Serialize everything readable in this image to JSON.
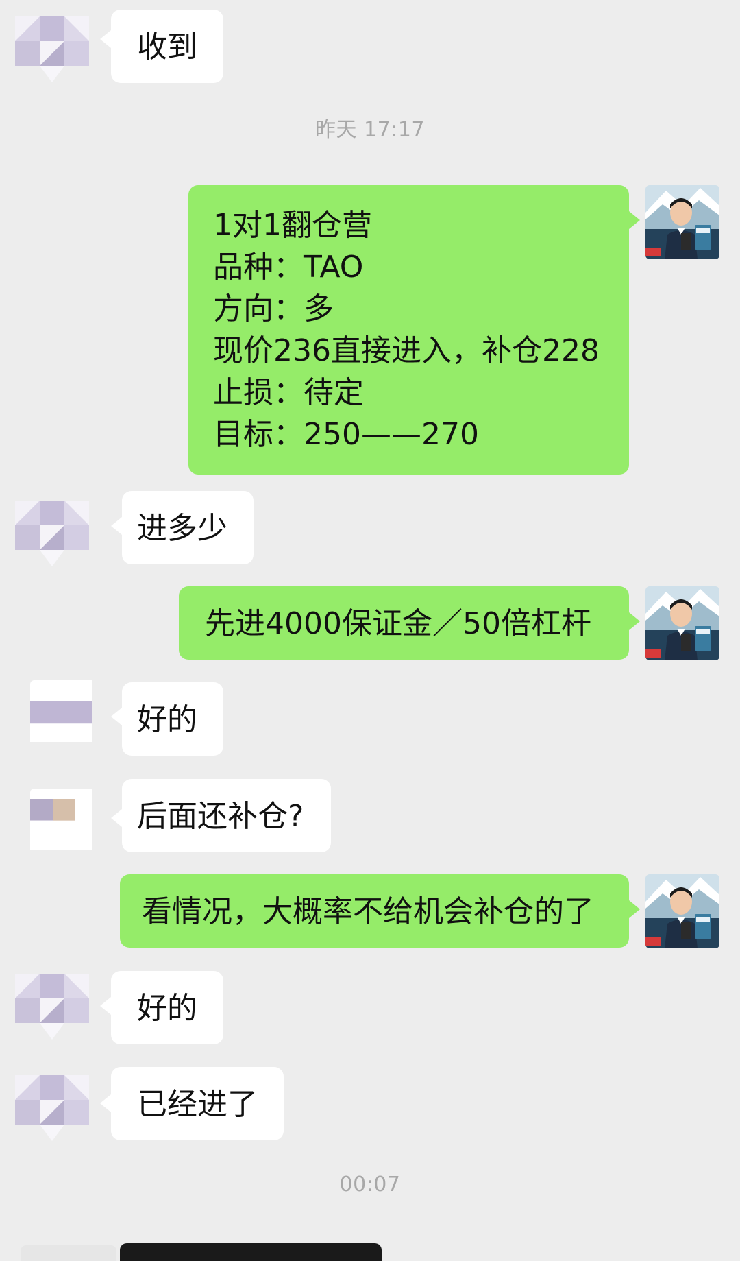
{
  "conversation": {
    "timestamps": [
      "昨天 17:17",
      "00:07"
    ],
    "messages": [
      {
        "sender": "other",
        "lines": [
          "收到"
        ]
      },
      {
        "sender": "me",
        "lines": [
          "1对1翻仓营",
          "品种：TAO",
          "方向：多",
          "现价236直接进入，补仓228",
          "止损：待定",
          "目标：250——270"
        ]
      },
      {
        "sender": "other",
        "lines": [
          "进多少"
        ]
      },
      {
        "sender": "me",
        "lines": [
          "先进4000保证金／50倍杠杆"
        ]
      },
      {
        "sender": "other",
        "lines": [
          "好的"
        ]
      },
      {
        "sender": "other",
        "lines": [
          "后面还补仓?"
        ]
      },
      {
        "sender": "me",
        "lines": [
          "看情况，大概率不给机会补仓的了"
        ]
      },
      {
        "sender": "other",
        "lines": [
          "好的"
        ]
      },
      {
        "sender": "other",
        "lines": [
          "已经进了"
        ]
      }
    ]
  },
  "colors": {
    "background": "#ededed",
    "bubble_me": "#95ec69",
    "bubble_other": "#ffffff",
    "timestamp_text": "#a8a8a8"
  },
  "icons": {
    "my_avatar": "my-avatar-icon",
    "contact_avatar": "contact-avatar-icon"
  }
}
